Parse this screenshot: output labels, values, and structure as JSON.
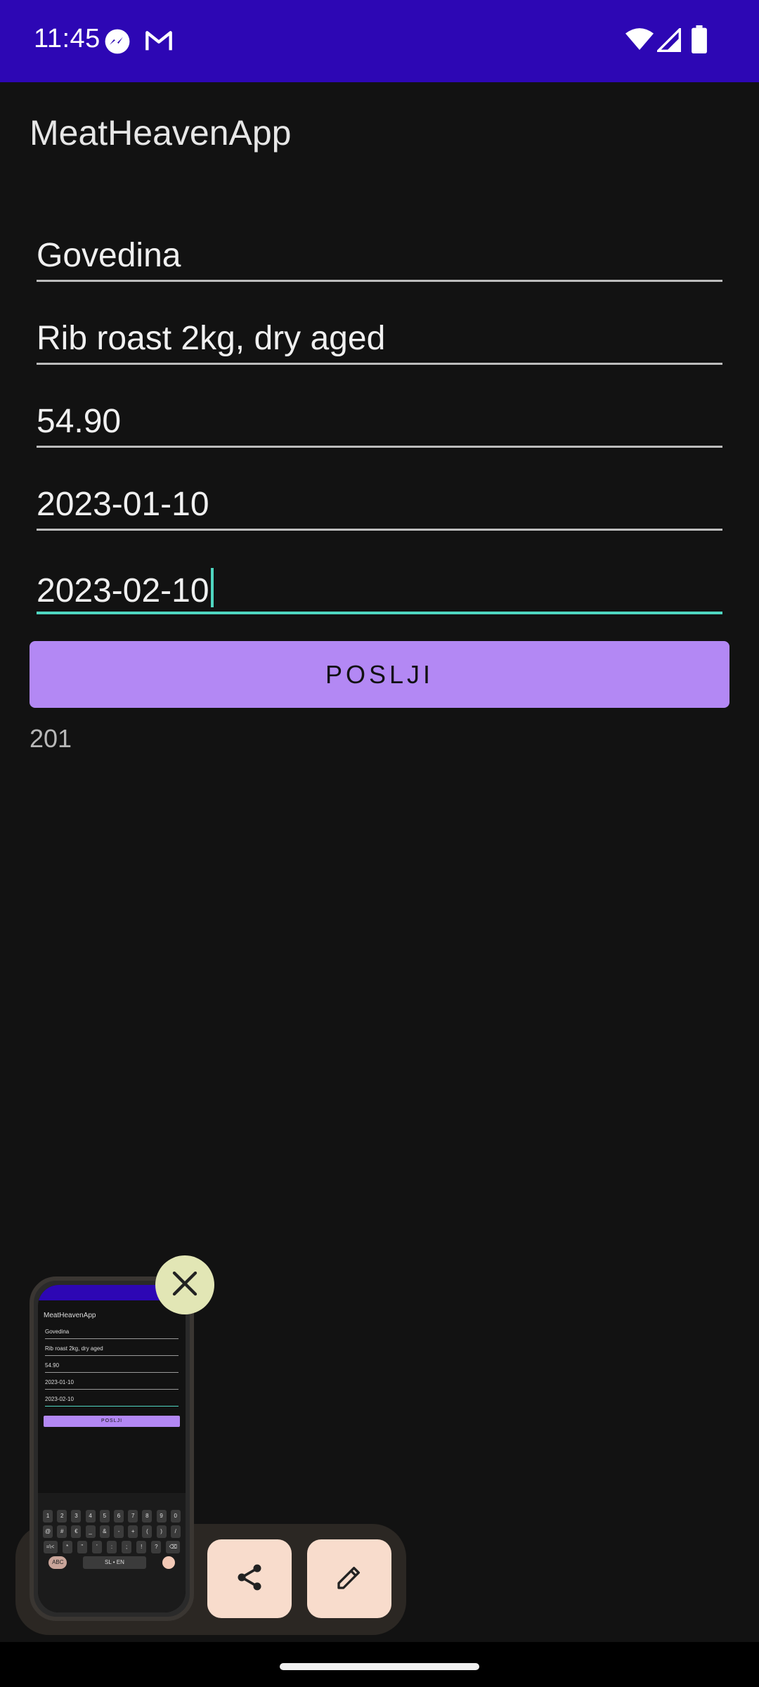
{
  "status_bar": {
    "time": "11:45",
    "notification_icons": [
      "messenger-icon",
      "gmail-icon"
    ],
    "system_icons": [
      "wifi-icon",
      "signal-icon",
      "battery-icon"
    ],
    "background_color": "#2d07b4"
  },
  "app_bar": {
    "title": "MeatHeavenApp"
  },
  "form": {
    "fields": [
      {
        "value": "Govedina"
      },
      {
        "value": "Rib roast 2kg, dry aged"
      },
      {
        "value": "54.90"
      },
      {
        "value": "2023-01-10"
      },
      {
        "value": "2023-02-10",
        "focused": true
      }
    ],
    "submit_label": "POSLJI",
    "accent_color": "#4fd6c0",
    "button_color": "#b388f4"
  },
  "response": {
    "text": "201"
  },
  "screenshot_overlay": {
    "thumbnail": {
      "title": "MeatHeavenApp",
      "fields": [
        "Govedina",
        "Rib roast 2kg, dry aged",
        "54.90",
        "2023-01-10",
        "2023-02-10"
      ],
      "button_label": "POSLJI",
      "keyboard_rows": [
        [
          "1",
          "2",
          "3",
          "4",
          "5",
          "6",
          "7",
          "8",
          "9",
          "0"
        ],
        [
          "@",
          "#",
          "€",
          "_",
          "&",
          "-",
          "+",
          "(",
          ")",
          "/"
        ],
        [
          "=\\<",
          "*",
          "\"",
          "'",
          ":",
          ";",
          "!",
          "?",
          "⌫"
        ]
      ],
      "keyboard_bottom": {
        "abc_label": "ABC",
        "space_label": "SL • EN"
      }
    },
    "actions": [
      "close-icon",
      "share-icon",
      "edit-icon"
    ]
  }
}
